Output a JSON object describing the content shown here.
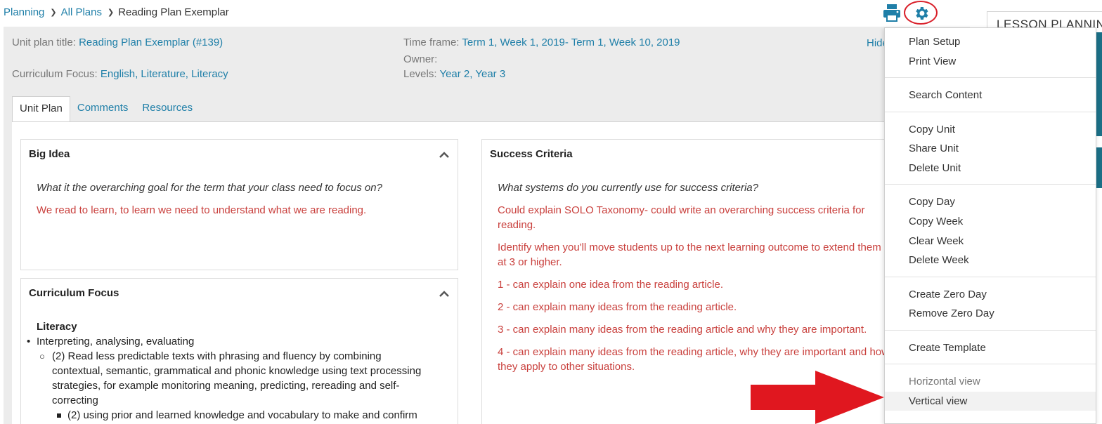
{
  "breadcrumb": {
    "items": [
      "Planning",
      "All Plans"
    ],
    "current": "Reading Plan Exemplar"
  },
  "header": {
    "unit_title_label": "Unit plan title:",
    "unit_title_value": "Reading Plan Exemplar (#139)",
    "curriculum_label": "Curriculum Focus:",
    "curriculum_values": [
      "English",
      "Literature",
      "Literacy"
    ],
    "timeframe_label": "Time frame:",
    "timeframe_value": "Term 1, Week 1, 2019- Term 1, Week 10, 2019",
    "owner_label": "Owner:",
    "levels_label": "Levels:",
    "levels_values": [
      "Year 2",
      "Year 3"
    ],
    "hide_label": "Hide"
  },
  "tabs": [
    "Unit Plan",
    "Comments",
    "Resources"
  ],
  "big_idea": {
    "title": "Big Idea",
    "question": "What it the overarching goal for the term that your class need to focus on?",
    "answer": "We read to learn, to learn we need to understand what we are reading."
  },
  "curriculum_focus": {
    "title": "Curriculum Focus",
    "subheading": "Literacy",
    "level1": "Interpreting, analysing, evaluating",
    "level2": "(2) Read less predictable texts with phrasing and fluency by combining contextual, semantic, grammatical and phonic knowledge using text processing strategies, for example monitoring meaning, predicting, rereading and self-correcting",
    "level3": "(2) using prior and learned knowledge and vocabulary to make and confirm"
  },
  "success_criteria": {
    "title": "Success Criteria",
    "question": "What systems do you currently use for success criteria?",
    "answers": [
      "Could explain SOLO Taxonomy- could write an overarching success criteria for reading.",
      "Identify when you'll move students up to the next learning outcome to extend them at 3 or higher.",
      "1 - can explain one idea from the reading article.",
      "2 - can explain many ideas from the reading article.",
      "3 - can explain many ideas from the reading article and why they are important.",
      "4 - can explain many ideas from the reading article, why they are important and how they apply to other situations."
    ]
  },
  "menu": {
    "items": [
      "Plan Setup",
      "Print View",
      "Search Content",
      "Copy Unit",
      "Share Unit",
      "Delete Unit",
      "Copy Day",
      "Copy Week",
      "Clear Week",
      "Delete Week",
      "Create Zero Day",
      "Remove Zero Day",
      "Create Template",
      "Horizontal view",
      "Vertical view"
    ]
  },
  "side_panel": {
    "title": "LESSON PLANNING"
  },
  "icons": [
    "print-icon",
    "gear-icon",
    "chevron-up-icon",
    "red-arrow-annotation"
  ],
  "colors": {
    "link": "#1f7fa8",
    "answer_text": "#c9403d",
    "header_bg": "#ececec",
    "annotation_red": "#e0171f",
    "panel_accent": "#1b6f86"
  }
}
